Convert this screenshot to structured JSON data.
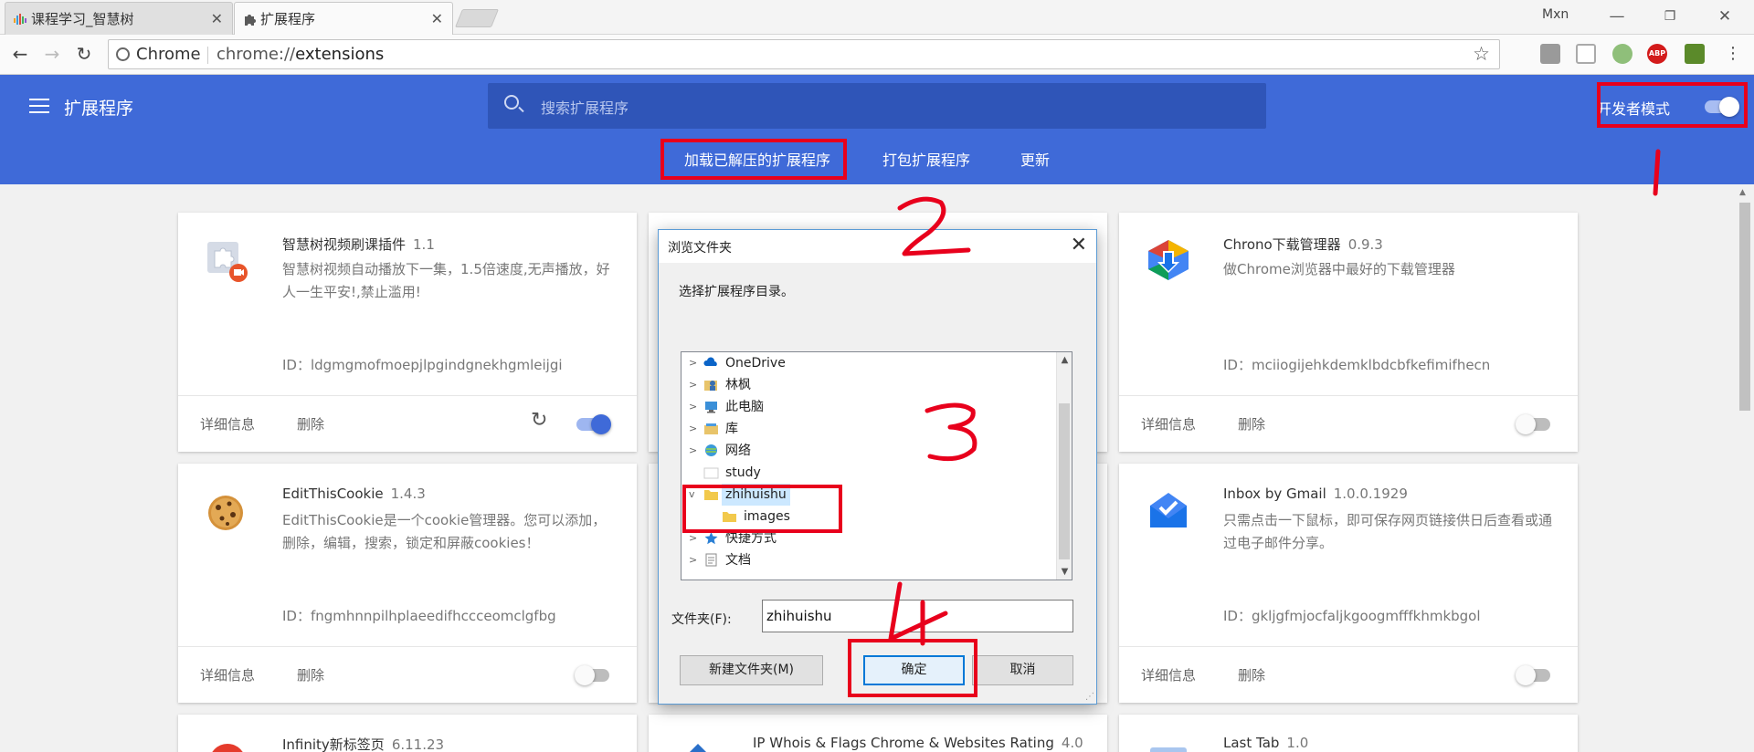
{
  "browser": {
    "tabs": [
      {
        "label": "课程学习_智慧树",
        "active": false
      },
      {
        "label": "扩展程序",
        "active": true
      }
    ],
    "user": "Mxn",
    "omnibox": {
      "site": "Chrome",
      "url_scheme": "chrome://",
      "url_path": "extensions"
    }
  },
  "header": {
    "title": "扩展程序",
    "search_placeholder": "搜索扩展程序",
    "dev_mode_label": "开发者模式",
    "dev_mode_on": true,
    "links": {
      "load_unpacked": "加载已解压的扩展程序",
      "pack": "打包扩展程序",
      "update": "更新"
    }
  },
  "card_actions": {
    "details": "详细信息",
    "remove": "删除"
  },
  "extensions": [
    {
      "name": "智慧树视频刷课插件",
      "version": "1.1",
      "desc": "智慧树视频自动播放下一集，1.5倍速度,无声播放，好人一生平安!,禁止滥用!",
      "id": "ID：ldgmgmofmoepjlpgindgnekhgmleijgi",
      "enabled": true,
      "icon": "puzzle-icon"
    },
    {
      "name": "Chrono下载管理器",
      "version": "0.9.3",
      "desc": "做Chrome浏览器中最好的下载管理器",
      "id": "ID：mciiogijehkdemklbdcbfkefimifhecn",
      "enabled": false,
      "icon": "download-arrow-icon"
    },
    {
      "name": "EditThisCookie",
      "version": "1.4.3",
      "desc": "EditThisCookie是一个cookie管理器。您可以添加，删除，编辑，搜索，锁定和屏蔽cookies！",
      "id": "ID：fngmhnnpilhplaeedifhccceomclgfbg",
      "enabled": false,
      "icon": "cookie-icon"
    },
    {
      "name": "Inbox by Gmail",
      "version": "1.0.0.1929",
      "desc": "只需点击一下鼠标，即可保存网页链接供日后查看或通过电子邮件分享。",
      "id": "ID：gkljgfmjocfaljkgoogmfffkhmkbgol",
      "enabled": false,
      "icon": "inbox-icon"
    },
    {
      "name": "Infinity新标签页",
      "version": "6.11.23",
      "icon": "infinity-icon"
    },
    {
      "name": "IP Whois & Flags Chrome & Websites Rating",
      "version": "4.0",
      "icon": "ip-whois-icon"
    },
    {
      "name": "Last Tab",
      "version": "1.0",
      "icon": "last-tab-icon"
    }
  ],
  "dialog": {
    "title": "浏览文件夹",
    "prompt": "选择扩展程序目录。",
    "tree": [
      {
        "label": "OneDrive",
        "icon": "onedrive-icon",
        "expandable": true
      },
      {
        "label": "林枫",
        "icon": "user-folder-icon",
        "expandable": true
      },
      {
        "label": "此电脑",
        "icon": "computer-icon",
        "expandable": true
      },
      {
        "label": "库",
        "icon": "library-icon",
        "expandable": true
      },
      {
        "label": "网络",
        "icon": "network-icon",
        "expandable": true
      },
      {
        "label": "study",
        "icon": "folder-icon",
        "expandable": false
      },
      {
        "label": "zhihuishu",
        "icon": "folder-icon",
        "expandable": true,
        "expanded": true,
        "selected": true
      },
      {
        "label": "images",
        "icon": "folder-icon",
        "expandable": false,
        "child": true
      },
      {
        "label": "快捷方式",
        "icon": "shortcut-icon",
        "expandable": true
      },
      {
        "label": "文档",
        "icon": "documents-icon",
        "expandable": true
      }
    ],
    "folder_label": "文件夹(F):",
    "folder_value": "zhihuishu",
    "buttons": {
      "new_folder": "新建文件夹(M)",
      "ok": "确定",
      "cancel": "取消"
    }
  },
  "colors": {
    "header_blue": "#3f6ad8",
    "annotation_red": "#e8001c",
    "dialog_border": "#5b9bd5"
  }
}
